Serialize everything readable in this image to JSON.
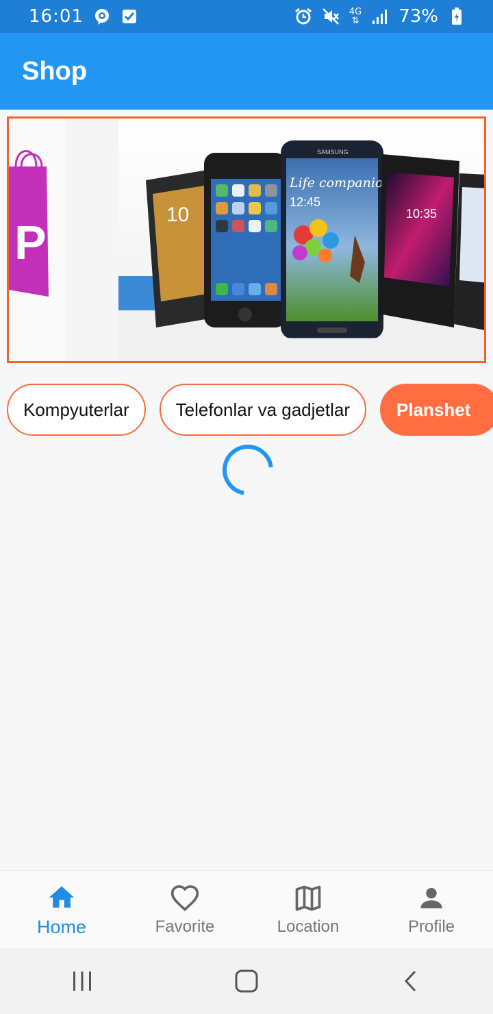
{
  "status_bar": {
    "time": "16:01",
    "battery": "73%",
    "network": "4G",
    "icons": [
      "chat-bubble-icon",
      "checkbox-icon",
      "alarm-icon",
      "mute-icon",
      "signal-icon",
      "battery-charging-icon"
    ]
  },
  "appbar": {
    "title": "Shop"
  },
  "banner": {
    "phone_text": "Life companion",
    "phone_time": "12:45",
    "phone_brand": "SAMSUNG",
    "left_bag_letter": "P"
  },
  "categories": [
    {
      "label": "Kompyuterlar",
      "active": false
    },
    {
      "label": "Telefonlar va gadjetlar",
      "active": false
    },
    {
      "label": "Planshet",
      "active": true
    }
  ],
  "bottom_nav": [
    {
      "label": "Home",
      "icon": "home-icon",
      "active": true
    },
    {
      "label": "Favorite",
      "icon": "heart-icon",
      "active": false
    },
    {
      "label": "Location",
      "icon": "map-icon",
      "active": false
    },
    {
      "label": "Profile",
      "icon": "person-icon",
      "active": false
    }
  ],
  "colors": {
    "primary": "#2196f3",
    "status_bar": "#1f7fd6",
    "accent": "#ff6e40",
    "chip_border": "#f06c3c"
  }
}
